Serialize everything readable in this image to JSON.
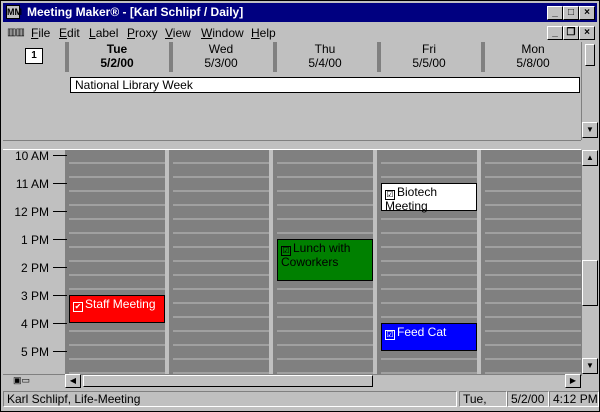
{
  "window": {
    "title": "Meeting Maker® - [Karl Schlipf / Daily]",
    "app_icon": "MM",
    "minimize": "_",
    "maximize": "□",
    "close": "×"
  },
  "menu": {
    "items": [
      "File",
      "Edit",
      "Label",
      "Proxy",
      "View",
      "Window",
      "Help"
    ],
    "mdi_minimize": "_",
    "mdi_restore": "❐",
    "mdi_close": "×"
  },
  "days": [
    {
      "name": "Tue",
      "date": "5/2/00",
      "selected": true
    },
    {
      "name": "Wed",
      "date": "5/3/00",
      "selected": false
    },
    {
      "name": "Thu",
      "date": "5/4/00",
      "selected": false
    },
    {
      "name": "Fri",
      "date": "5/5/00",
      "selected": false
    },
    {
      "name": "Mon",
      "date": "5/8/00",
      "selected": false
    }
  ],
  "banner": "National Library Week",
  "times": [
    "10 AM",
    "11 AM",
    "12 PM",
    "1 PM",
    "2 PM",
    "3 PM",
    "4 PM",
    "5 PM"
  ],
  "events": [
    {
      "day": 0,
      "label": "Staff Meeting",
      "color": "#ff0000",
      "text_color": "#ffffff",
      "check": "✔",
      "start": 15.0,
      "end": 16.0
    },
    {
      "day": 2,
      "label": "Lunch with Coworkers",
      "color": "#008000",
      "text_color": "#000000",
      "check": "☑",
      "start": 13.0,
      "end": 14.5
    },
    {
      "day": 3,
      "label": "Biotech Meeting",
      "color": "#ffffff",
      "text_color": "#000000",
      "check": "☑",
      "start": 11.0,
      "end": 12.0
    },
    {
      "day": 3,
      "label": "Feed Cat",
      "color": "#0000ff",
      "text_color": "#ffffff",
      "check": "☑",
      "start": 16.0,
      "end": 17.0
    }
  ],
  "status": {
    "user": "Karl Schlipf, Life-Meeting",
    "day": "Tue,",
    "date": "5/2/00",
    "time": "4:12 PM"
  },
  "colors": {
    "titlebar": "#000080",
    "grid_dark": "#808080",
    "grid_light": "#a0a0a0"
  }
}
